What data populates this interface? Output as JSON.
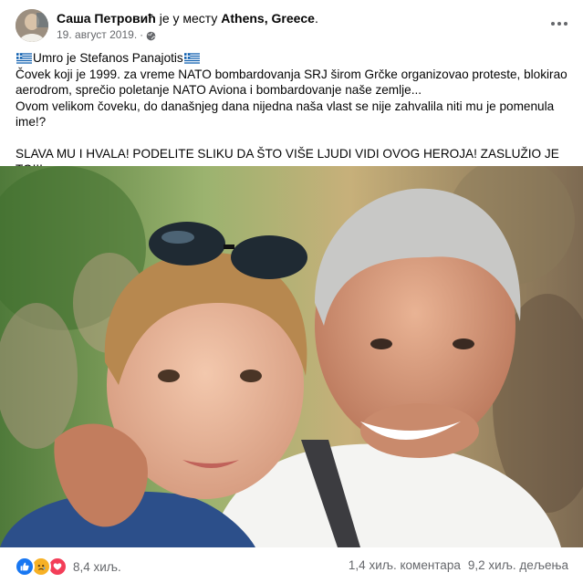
{
  "post": {
    "author": "Саша Петровић",
    "connector": " је у месту ",
    "place": "Athens, Greece",
    "place_suffix": ".",
    "date": "19. август 2019.",
    "separator": "·",
    "privacy_icon": "globe-icon",
    "more_icon": "more-horizontal-icon"
  },
  "text": {
    "line1": "Umro je Stefanos Panajotis",
    "line2": "Čovek koji je 1999. za vreme NATO bombardovanja SRJ širom Grčke organizovao proteste, blokirao aerodrom, sprečio poletanje NATO Aviona i bombardovanje naše zemlje...",
    "line3": "Ovom velikom čoveku, do današnjeg dana nijedna naša vlast se nije zahvalila niti mu je pomenula ime!?",
    "line4": "SLAVA MU I HVALA! PODELITE SLIKU DA ŠTO VIŠE LJUDI VIDI OVOG HEROJA! ZASLUŽIO JE TO!!!"
  },
  "photo": {
    "subject": "man with grey hair embracing a boy with sunglasses on his head"
  },
  "footer": {
    "reaction_icons": [
      "like-icon",
      "sad-icon",
      "love-icon"
    ],
    "reactions_count": "8,4 хиљ.",
    "comments": "1,4 хиљ. коментара",
    "shares": "9,2 хиљ. дељења"
  },
  "colors": {
    "text": "#050505",
    "muted": "#65676b",
    "like": "#1877f2",
    "sad": "#f7b125",
    "love": "#f33e58"
  }
}
